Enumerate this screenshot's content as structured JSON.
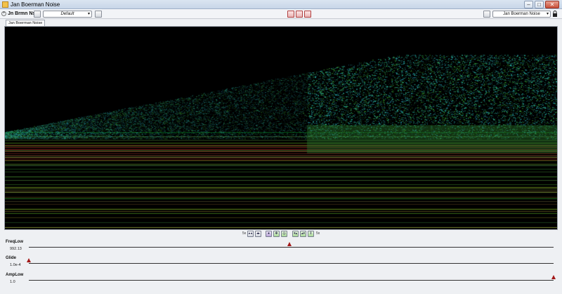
{
  "window": {
    "title": "Jan Boerman Noise",
    "minimize": "–",
    "maximize": "□",
    "close": "✕"
  },
  "toolbar": {
    "plugin_short_name": "Jn Brmn Ns",
    "preset_value": "Default",
    "preset_arrow": "▾",
    "instrument_value": "Jan Boerman Noise",
    "instrument_arrow": "▾"
  },
  "tabs": [
    {
      "label": "Jan Boerman Noise"
    }
  ],
  "viewbar": {
    "zoom_in_label": "5x",
    "zoom_out_label": "5x",
    "buttons": [
      "h-shrink",
      "h-expand",
      "select",
      "move",
      "target",
      "v-shrink",
      "v-expand",
      "v-fit"
    ]
  },
  "params": [
    {
      "name": "FreqLow",
      "value": "992.13",
      "position": 0.497
    },
    {
      "name": "Glide",
      "value": "1.0e-4",
      "position": 0.0
    },
    {
      "name": "AmpLow",
      "value": "1.0",
      "position": 1.0
    }
  ],
  "colors": {
    "accent": "#a31818",
    "spectro_background": "#000000",
    "spectro_low": "#2a6e2a",
    "spectro_mid": "#2fb3a8",
    "spectro_high": "#b83a2a"
  }
}
